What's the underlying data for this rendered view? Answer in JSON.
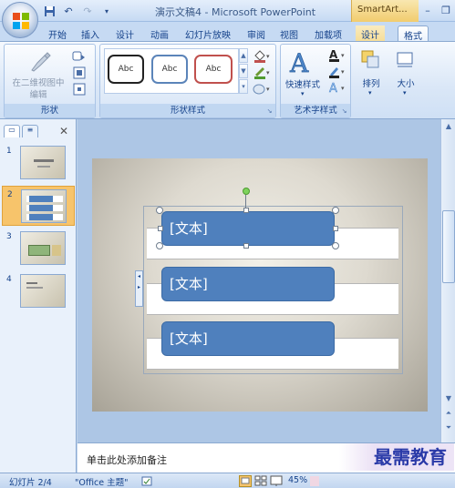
{
  "window": {
    "doc_title": "演示文稿4 - Microsoft PowerPoint",
    "context_tab": "SmartArt...",
    "qat": [
      "save-icon",
      "undo-icon",
      "redo-icon",
      "customize-icon"
    ]
  },
  "tabs": [
    "开始",
    "插入",
    "设计",
    "动画",
    "幻灯片放映",
    "审阅",
    "视图",
    "加载项",
    "设计",
    "格式"
  ],
  "active_tab": "格式",
  "ribbon": {
    "shape_group": {
      "edit_in_2d": "在二维视图中编辑",
      "label": "形状"
    },
    "shape_styles": {
      "gallery": [
        "Abc",
        "Abc",
        "Abc"
      ],
      "label": "形状样式"
    },
    "wordart": {
      "quick_styles": "快速样式",
      "label": "艺术字样式"
    },
    "arrange": {
      "label": "排列"
    },
    "size": {
      "label": "大小"
    }
  },
  "slide_pane": {
    "slides": [
      "1",
      "2",
      "3",
      "4"
    ],
    "selected": 2
  },
  "slide": {
    "boxes": [
      "[文本]",
      "[文本]",
      "[文本]"
    ]
  },
  "notes": {
    "placeholder": "单击此处添加备注"
  },
  "watermark": "最需教育",
  "status": {
    "slide_of": "幻灯片 2/4",
    "theme": "\"Office 主题\"",
    "zoom": "45%"
  },
  "colors": {
    "shape_fill": "#4f80bd",
    "ribbon_bg": "#dae7f7",
    "selected_thumb": "#f7c46b"
  }
}
